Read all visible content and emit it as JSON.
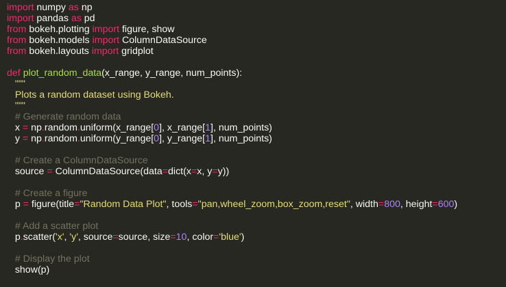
{
  "theme": {
    "background": "#272822",
    "colors": {
      "kw": "#f92672",
      "txt": "#f8f8f2",
      "fn": "#a6e22e",
      "str": "#e6db74",
      "num": "#ae81ff",
      "com": "#75715e"
    }
  },
  "code": {
    "lines": [
      [
        [
          "kw",
          "import"
        ],
        [
          "txt",
          " numpy "
        ],
        [
          "kw",
          "as"
        ],
        [
          "txt",
          " np"
        ]
      ],
      [
        [
          "kw",
          "import"
        ],
        [
          "txt",
          " pandas "
        ],
        [
          "kw",
          "as"
        ],
        [
          "txt",
          " pd"
        ]
      ],
      [
        [
          "kw",
          "from"
        ],
        [
          "txt",
          " bokeh.plotting "
        ],
        [
          "kw",
          "import"
        ],
        [
          "txt",
          " figure, show"
        ]
      ],
      [
        [
          "kw",
          "from"
        ],
        [
          "txt",
          " bokeh.models "
        ],
        [
          "kw",
          "import"
        ],
        [
          "txt",
          " ColumnDataSource"
        ]
      ],
      [
        [
          "kw",
          "from"
        ],
        [
          "txt",
          " bokeh.layouts "
        ],
        [
          "kw",
          "import"
        ],
        [
          "txt",
          " gridplot"
        ]
      ],
      [],
      [
        [
          "kw",
          "def"
        ],
        [
          "txt",
          " "
        ],
        [
          "fn",
          "plot_random_data"
        ],
        [
          "txt",
          "(x_range, y_range, num_points):"
        ]
      ],
      [
        [
          "txt",
          "   "
        ],
        [
          "str",
          "\"\"\""
        ]
      ],
      [
        [
          "txt",
          "   "
        ],
        [
          "str",
          "Plots a random dataset using Bokeh."
        ]
      ],
      [
        [
          "txt",
          "   "
        ],
        [
          "str",
          "\"\"\""
        ]
      ],
      [
        [
          "txt",
          "   "
        ],
        [
          "com",
          "# Generate random data"
        ]
      ],
      [
        [
          "txt",
          "   x "
        ],
        [
          "kw",
          "="
        ],
        [
          "txt",
          " np"
        ],
        [
          "kw",
          "."
        ],
        [
          "txt",
          "random"
        ],
        [
          "kw",
          "."
        ],
        [
          "txt",
          "uniform(x_range["
        ],
        [
          "num",
          "0"
        ],
        [
          "txt",
          "], x_range["
        ],
        [
          "num",
          "1"
        ],
        [
          "txt",
          "], num_points)"
        ]
      ],
      [
        [
          "txt",
          "   y "
        ],
        [
          "kw",
          "="
        ],
        [
          "txt",
          " np"
        ],
        [
          "kw",
          "."
        ],
        [
          "txt",
          "random"
        ],
        [
          "kw",
          "."
        ],
        [
          "txt",
          "uniform(y_range["
        ],
        [
          "num",
          "0"
        ],
        [
          "txt",
          "], y_range["
        ],
        [
          "num",
          "1"
        ],
        [
          "txt",
          "], num_points)"
        ]
      ],
      [],
      [
        [
          "txt",
          "   "
        ],
        [
          "com",
          "# Create a ColumnDataSource"
        ]
      ],
      [
        [
          "txt",
          "   source "
        ],
        [
          "kw",
          "="
        ],
        [
          "txt",
          " ColumnDataSource(data"
        ],
        [
          "kw",
          "="
        ],
        [
          "txt",
          "dict(x"
        ],
        [
          "kw",
          "="
        ],
        [
          "txt",
          "x, y"
        ],
        [
          "kw",
          "="
        ],
        [
          "txt",
          "y))"
        ]
      ],
      [],
      [
        [
          "txt",
          "   "
        ],
        [
          "com",
          "# Create a figure"
        ]
      ],
      [
        [
          "txt",
          "   p "
        ],
        [
          "kw",
          "="
        ],
        [
          "txt",
          " figure(title"
        ],
        [
          "kw",
          "="
        ],
        [
          "str",
          "\"Random Data Plot\""
        ],
        [
          "txt",
          ", tools"
        ],
        [
          "kw",
          "="
        ],
        [
          "str",
          "\"pan,wheel_zoom,box_zoom,reset\""
        ],
        [
          "txt",
          ", width"
        ],
        [
          "kw",
          "="
        ],
        [
          "num",
          "800"
        ],
        [
          "txt",
          ", height"
        ],
        [
          "kw",
          "="
        ],
        [
          "num",
          "600"
        ],
        [
          "txt",
          ")"
        ]
      ],
      [],
      [
        [
          "txt",
          "   "
        ],
        [
          "com",
          "# Add a scatter plot"
        ]
      ],
      [
        [
          "txt",
          "   p"
        ],
        [
          "kw",
          "."
        ],
        [
          "txt",
          "scatter("
        ],
        [
          "str",
          "'x'"
        ],
        [
          "txt",
          ", "
        ],
        [
          "str",
          "'y'"
        ],
        [
          "txt",
          ", source"
        ],
        [
          "kw",
          "="
        ],
        [
          "txt",
          "source, size"
        ],
        [
          "kw",
          "="
        ],
        [
          "num",
          "10"
        ],
        [
          "txt",
          ", color"
        ],
        [
          "kw",
          "="
        ],
        [
          "str",
          "'blue'"
        ],
        [
          "txt",
          ")"
        ]
      ],
      [],
      [
        [
          "txt",
          "   "
        ],
        [
          "com",
          "# Display the plot"
        ]
      ],
      [
        [
          "txt",
          "   show(p)"
        ]
      ]
    ]
  }
}
